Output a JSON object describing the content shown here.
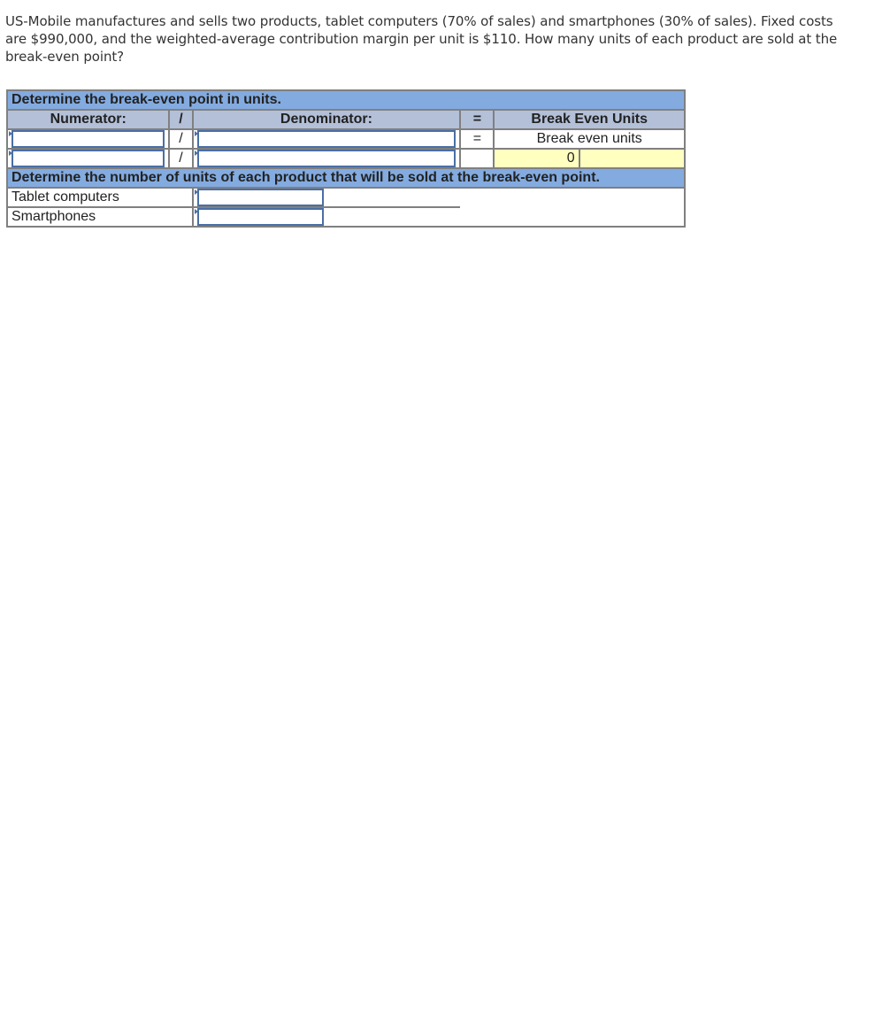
{
  "question": "US-Mobile manufactures and sells two products, tablet computers (70% of sales) and smartphones (30% of sales). Fixed costs are $990,000, and the weighted-average contribution margin per unit is $110. How many units of each product are sold at the break-even point?",
  "part1": {
    "title": "Determine the break-even point in units.",
    "headers": {
      "numerator": "Numerator:",
      "divide": "/",
      "denominator": "Denominator:",
      "equals": "=",
      "result": "Break Even Units"
    },
    "rows": [
      {
        "numerator": "",
        "divide": "/",
        "denominator": "",
        "equals": "=",
        "result_label": "Break even units"
      },
      {
        "numerator": "",
        "divide": "/",
        "denominator": "",
        "equals": "",
        "result_value": "0"
      }
    ]
  },
  "part2": {
    "title": "Determine the number of units of each product that will be sold at the break-even point.",
    "rows": [
      {
        "label": "Tablet computers",
        "value": ""
      },
      {
        "label": "Smartphones",
        "value": ""
      }
    ]
  },
  "colors": {
    "section_header_bg": "#83abe0",
    "column_header_bg": "#b3c0d8",
    "result_bg": "#ffffc0",
    "input_border": "#4a6fa5"
  }
}
